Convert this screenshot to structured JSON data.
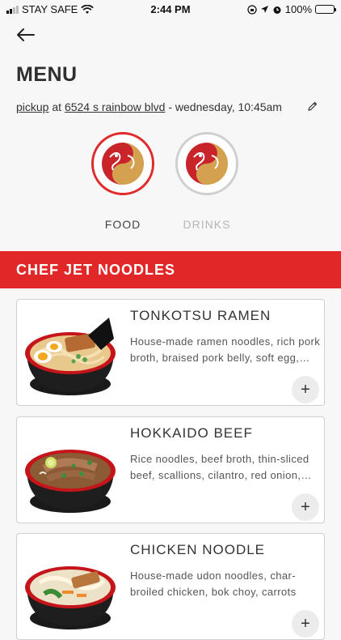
{
  "status_bar": {
    "carrier": "STAY SAFE",
    "time": "2:44 PM",
    "battery": "100%"
  },
  "page": {
    "title": "MENU",
    "order": {
      "mode": "pickup",
      "at": "at",
      "address": "6524 s rainbow blvd",
      "when": "- wednesday, 10:45am"
    }
  },
  "categories": [
    {
      "label": "FOOD",
      "active": true
    },
    {
      "label": "DRINKS",
      "active": false
    }
  ],
  "section": {
    "title": "CHEF JET NOODLES"
  },
  "items": [
    {
      "name": "TONKOTSU RAMEN",
      "description": "House-made ramen noodles, rich pork broth, braised pork belly, soft egg, scallions, nori",
      "add_label": "+"
    },
    {
      "name": "HOKKAIDO BEEF",
      "description": "Rice noodles, beef broth, thin-sliced beef, scallions, cilantro, red onion, lime",
      "add_label": "+"
    },
    {
      "name": "CHICKEN NOODLE",
      "description": "House-made udon noodles, char-broiled chicken, bok choy, carrots",
      "add_label": "+"
    }
  ],
  "colors": {
    "accent": "#e12727",
    "inactive": "#b5b5b5"
  }
}
